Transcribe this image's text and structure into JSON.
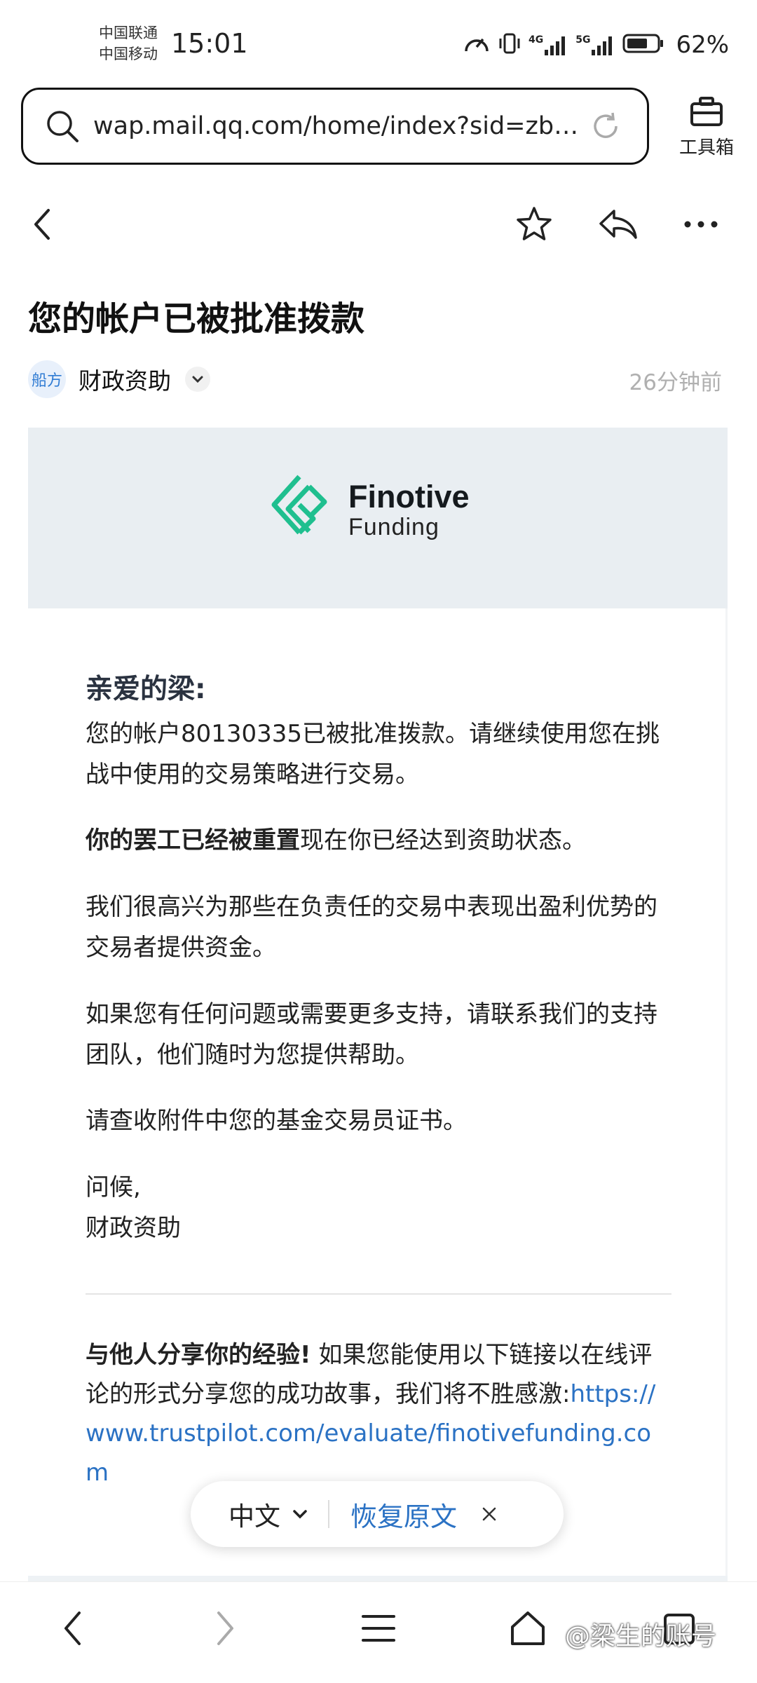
{
  "status_bar": {
    "carrier_1": "中国联通",
    "carrier_2": "中国移动",
    "time": "15:01",
    "net_1": "4G",
    "net_2": "5G",
    "battery": "62%"
  },
  "url_bar": {
    "url": "wap.mail.qq.com/home/index?sid=zb11...",
    "toolbox_label": "工具箱"
  },
  "email": {
    "subject": "您的帐户已被批准拨款",
    "sender_avatar": "船方",
    "sender": "财政资助",
    "time": "26分钟前",
    "logo_name": "Finotive",
    "logo_sub": "Funding",
    "greeting": "亲爱的梁:",
    "p1": "您的帐户80130335已被批准拨款。请继续使用您在挑战中使用的交易策略进行交易。",
    "p2_bold": "你的罢工已经被重置",
    "p2_rest": "现在你已经达到资助状态。",
    "p3": "我们很高兴为那些在负责任的交易中表现出盈利优势的交易者提供资金。",
    "p4": "如果您有任何问题或需要更多支持，请联系我们的支持团队，他们随时为您提供帮助。",
    "p5": "请查收附件中您的基金交易员证书。",
    "signoff": "问候,",
    "signature": "财政资助",
    "p7_bold": "与他人分享你的经验!",
    "p7_rest": " 如果您能使用以下链接以在线评论的形式分享您的成功故事，我们将不胜感激:",
    "p7_link": "https://www.trustpilot.com/evaluate/finotivefunding.com"
  },
  "translate": {
    "language": "中文",
    "restore": "恢复原文"
  },
  "watermark": "@梁生的账号",
  "colors": {
    "link": "#2b72c4",
    "logo_green": "#1fbf8f",
    "banner_bg": "#e9eef2"
  }
}
